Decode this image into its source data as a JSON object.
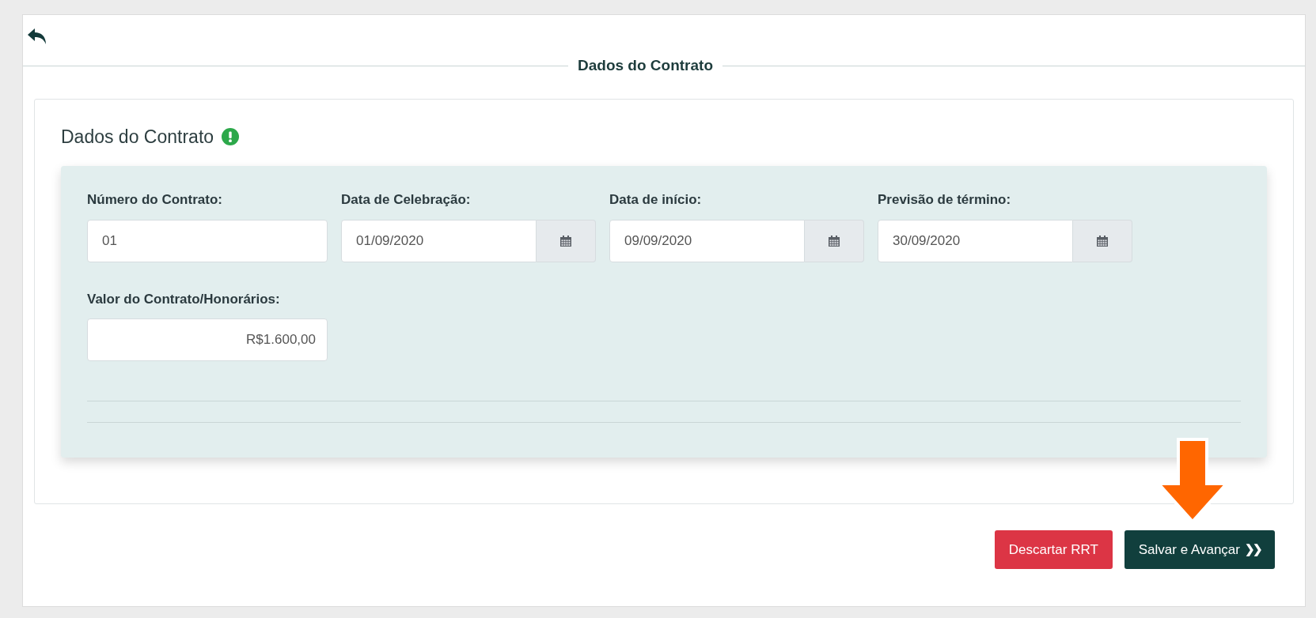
{
  "legend": "Dados do Contrato",
  "section": {
    "title": "Dados do Contrato"
  },
  "fields": [
    {
      "kind": "text",
      "label": "Número do Contrato:",
      "value": "01"
    },
    {
      "kind": "date",
      "label": "Data de Celebração:",
      "value": "01/09/2020"
    },
    {
      "kind": "date",
      "label": "Data de início:",
      "value": "09/09/2020"
    },
    {
      "kind": "date",
      "label": "Previsão de término:",
      "value": "30/09/2020"
    },
    {
      "kind": "money",
      "label": "Valor do Contrato/Honorários:",
      "value": "R$1.600,00"
    }
  ],
  "buttons": [
    {
      "kind": "danger",
      "label": "Descartar RRT"
    },
    {
      "kind": "primary",
      "label": "Salvar e Avançar",
      "trailing": "❯❯"
    }
  ]
}
